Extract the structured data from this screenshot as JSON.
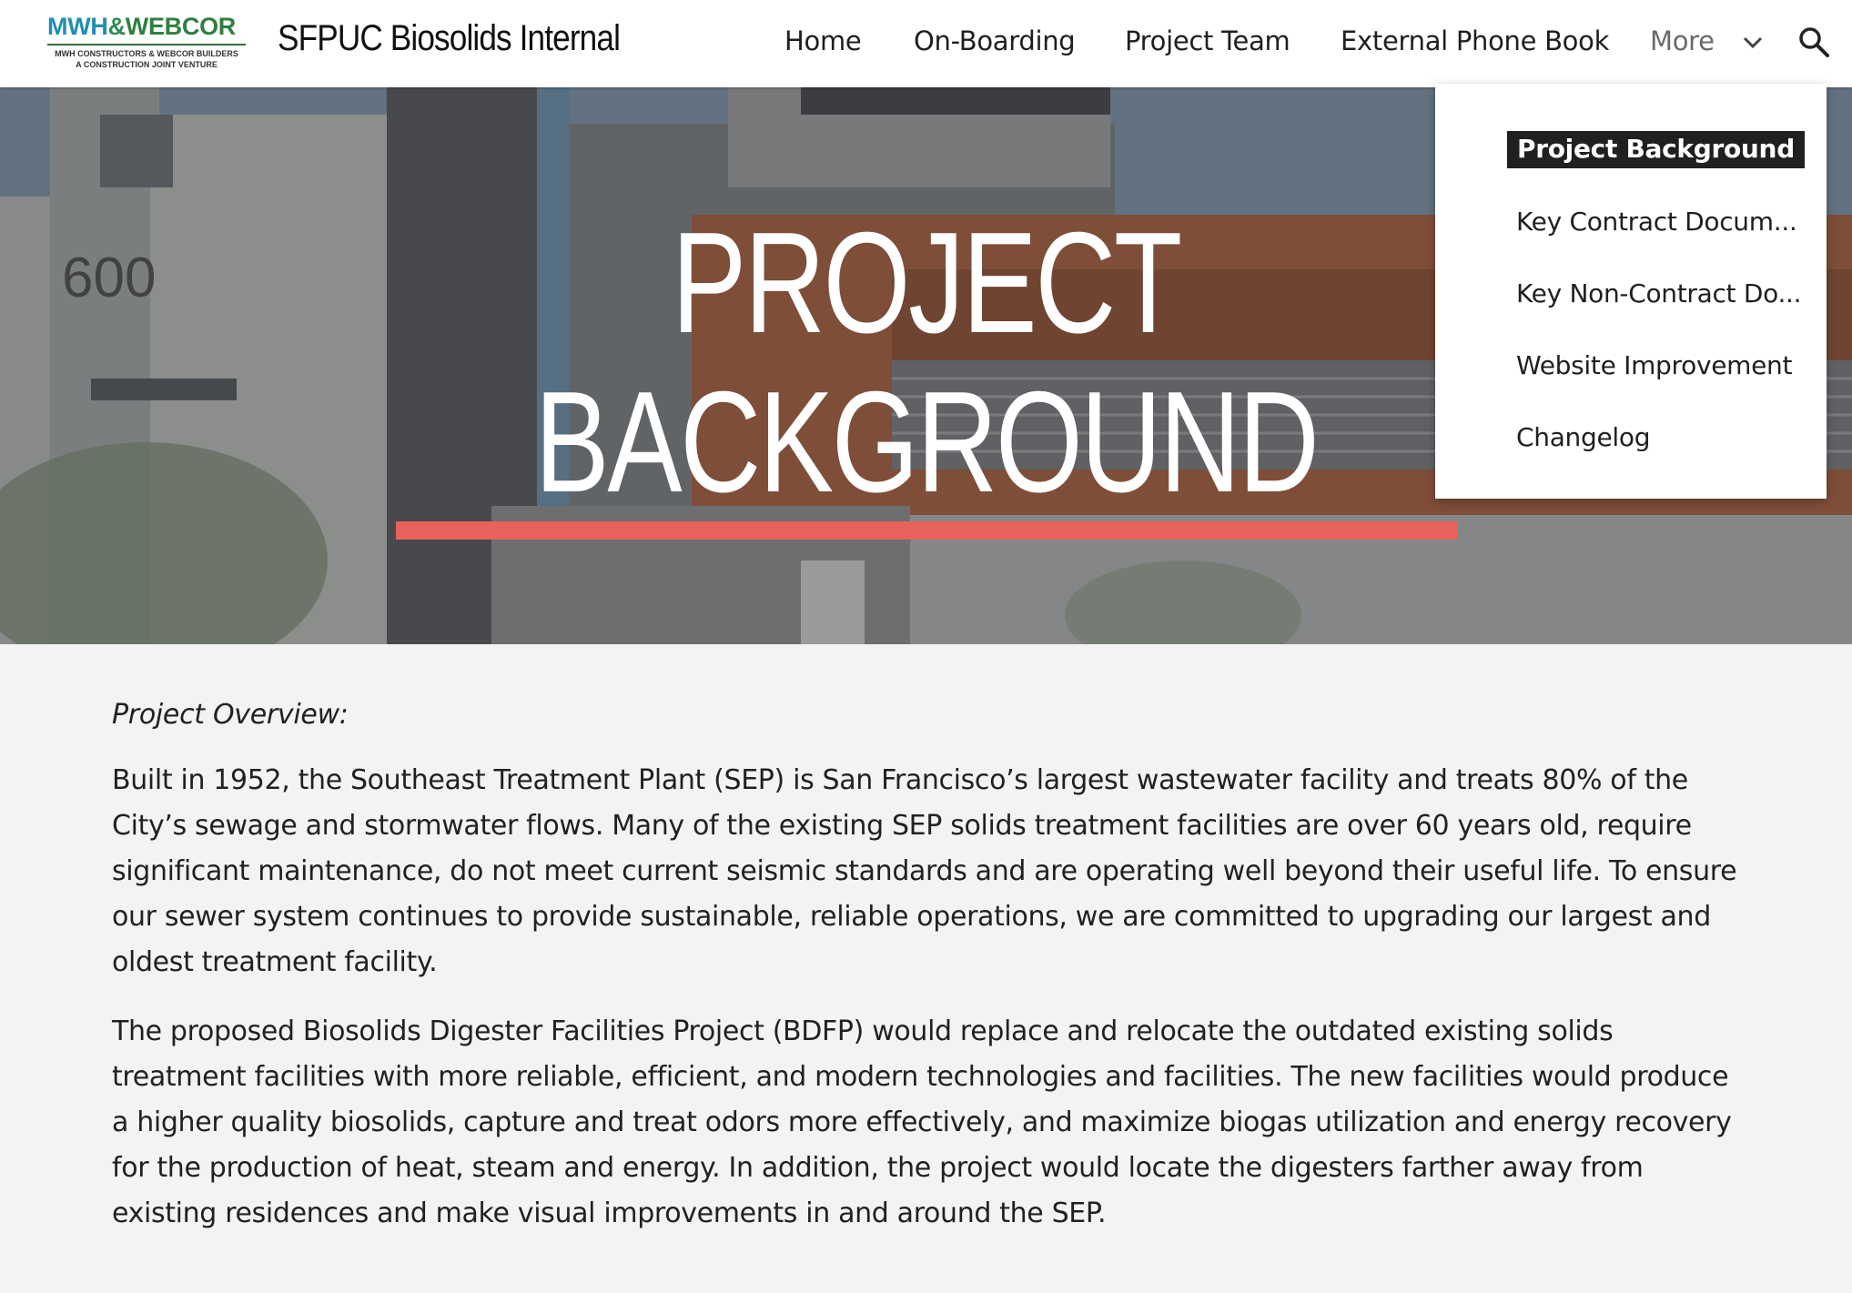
{
  "header": {
    "logo": {
      "main_a": "MWH",
      "amp": "&",
      "main_b": "WEBCOR",
      "sub_line1": "MWH CONSTRUCTORS & WEBCOR BUILDERS",
      "sub_line2": "A CONSTRUCTION JOINT VENTURE"
    },
    "site_title": "SFPUC Biosolids Internal",
    "nav": [
      {
        "label": "Home"
      },
      {
        "label": "On-Boarding"
      },
      {
        "label": "Project Team"
      },
      {
        "label": "External Phone Book"
      },
      {
        "label": "More"
      }
    ],
    "icons": {
      "more": "chevron-down-icon",
      "search": "search-icon"
    }
  },
  "hero": {
    "title_line1": "PROJECT",
    "title_line2": "BACKGROUND",
    "accent_color": "#e8625b"
  },
  "dropdown": {
    "items": [
      {
        "label": "Project Background",
        "active": true
      },
      {
        "label": "Key Contract Docum..."
      },
      {
        "label": "Key Non-Contract Do..."
      },
      {
        "label": "Website Improvement"
      },
      {
        "label": "Changelog"
      }
    ]
  },
  "content": {
    "overview_heading": "Project Overview:",
    "paragraph1": "Built in 1952, the Southeast Treatment Plant (SEP) is San Francisco’s largest wastewater facility and treats 80% of the City’s sewage and stormwater flows. Many of the existing SEP solids treatment facilities are over 60 years old, require significant maintenance, do not meet current seismic standards and are operating well beyond their useful life. To ensure our sewer system continues to provide sustainable, reliable operations, we are committed to upgrading our largest and oldest treatment facility.",
    "paragraph2": "The proposed Biosolids Digester Facilities Project (BDFP) would replace and relocate the outdated existing solids treatment facilities with more reliable, efficient, and modern technologies and facilities. The new facilities would produce a higher quality biosolids, capture and treat odors more effectively, and maximize biogas utilization and energy recovery for the production of heat, steam and energy. In addition, the project would locate the digesters farther away from existing residences and make visual improvements in and around the SEP."
  }
}
